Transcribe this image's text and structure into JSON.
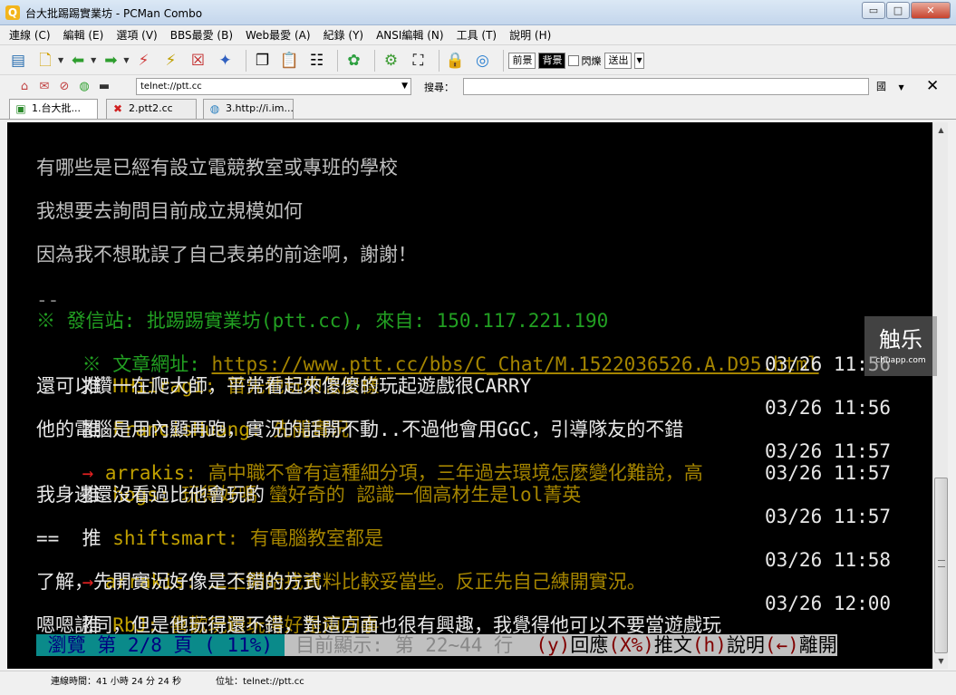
{
  "window": {
    "title": "台大批踢踢實業坊 - PCMan Combo",
    "app_icon": "pcman-icon",
    "controls": {
      "minimize": "▭",
      "maximize": "□",
      "close": "✕"
    }
  },
  "menu": [
    "連線 (C)",
    "編輯 (E)",
    "選項 (V)",
    "BBS最愛 (B)",
    "Web最愛 (A)",
    "紀錄 (Y)",
    "ANSI編輯 (N)",
    "工具 (T)",
    "說明 (H)"
  ],
  "toolbar": {
    "foreground_label": "前景",
    "background_label": "背景",
    "blink_label": "閃爍",
    "send_label": "送出"
  },
  "addressbar": {
    "address": "telnet://ptt.cc",
    "search_label": "搜尋：",
    "search_value": "",
    "lang": "國"
  },
  "tabs": [
    {
      "label": "1.台大批...",
      "icon": "terminal-icon",
      "active": true
    },
    {
      "label": "2.ptt2.cc",
      "icon": "disconnected-icon",
      "active": false
    },
    {
      "label": "3.http://i.im...",
      "icon": "web-icon",
      "active": false
    }
  ],
  "terminal": {
    "lines": [
      {
        "text": "有哪些是已經有設立電競教室或專班的學校",
        "color": "g"
      },
      {
        "text": "我想要去詢問目前成立規模如何",
        "color": "g"
      },
      {
        "text": "因為我不想耽誤了自己表弟的前途啊，謝謝！",
        "color": "g"
      }
    ],
    "signature_sep": "--",
    "origin": "※ 發信站: 批踢踢實業坊(ptt.cc), 來自: 150.117.221.190",
    "url_prefix": "※ 文章網址: ",
    "url": "https://www.ptt.cc/bbs/C_Chat/M.1522036526.A.D95.html",
    "pushes": [
      {
        "tag": "推",
        "user": "HHiiragi",
        "content": ": 首先他玩的怎麼樣",
        "time": "03/26 11:56"
      },
      {
        "cont": "還可以鑽一在爬大師，平常看起來傻傻的玩起遊戲很CARRY"
      },
      {
        "tag": "推",
        "user": "FrancisHuang",
        "content": ": 先開實況",
        "time": "03/26 11:56"
      },
      {
        "cont": "他的電腦是用內顯再跑，實況的話開不動..不過他會用GGC，引導隊友的不錯"
      },
      {
        "tag": "→",
        "user": "arrakis",
        "content": ": 高中職不會有這種細分項，三年過去環境怎麼變化難說，高",
        "time": "03/26 11:57"
      },
      {
        "tag": "推",
        "user": "hogs",
        "content": ": 玩得好嗎 蠻好奇的 認識一個高材生是lol菁英",
        "time": "03/26 11:57"
      },
      {
        "cont": "我身邊還沒看過比他會玩的"
      },
      {
        "tag": "推",
        "user": "shiftsmart",
        "content": ": 有電腦教室都是",
        "time": "03/26 11:57"
      },
      {
        "cont": "=="
      },
      {
        "tag": "→",
        "user": "arrakis",
        "content": ": 二上開始找資料比較妥當些。反正先自己練開實況。",
        "time": "03/26 11:58"
      },
      {
        "cont": "了解，先開實況好像是不錯的方式"
      },
      {
        "tag": "推",
        "user": "RbJ",
        "content": ": 喜歡玩跟玩得好是兩回事",
        "time": "03/26 12:00"
      },
      {
        "cont": "嗯嗯認同，但是他玩得還不錯，對這方面也很有興趣，我覺得他可以不要當遊戲玩"
      }
    ],
    "status": {
      "browse": " 瀏覽 第 2/8 頁 ( 11%) ",
      "showing": " 目前顯示: 第 22~44 行 ",
      "reply_key": "(y)",
      "reply": "回應",
      "push_key": "(X%)",
      "push": "推文",
      "help_key": "(h)",
      "help": "說明",
      "exit_key": "(←)",
      "exit": "離開"
    }
  },
  "watermark": {
    "main": "触乐",
    "sub": "chuapp.com"
  },
  "statusbar": {
    "connection": "連線時間：41 小時 24 分 24 秒",
    "address": "位址：telnet://ptt.cc"
  }
}
